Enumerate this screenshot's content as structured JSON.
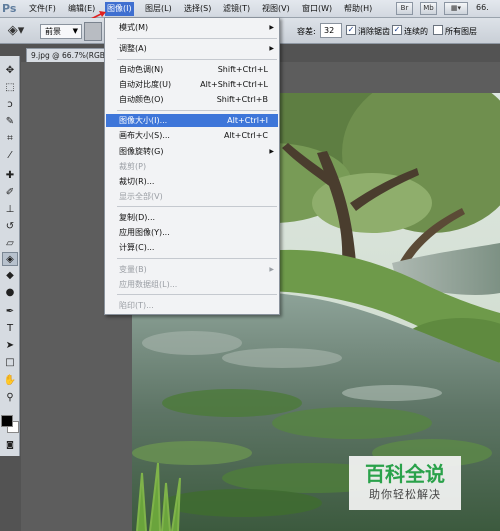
{
  "app": {
    "logo": "Ps"
  },
  "menubar": {
    "items": [
      "文件(F)",
      "编辑(E)",
      "图像(I)",
      "图层(L)",
      "选择(S)",
      "滤镜(T)",
      "视图(V)",
      "窗口(W)",
      "帮助(H)"
    ],
    "active_index": 2,
    "buttons": [
      "Br",
      "Mb"
    ],
    "zoom": "66."
  },
  "options": {
    "mode_value": "前景",
    "tolerance_label": "容差:",
    "tolerance_value": "32",
    "checkboxes": [
      {
        "label": "消除锯齿",
        "checked": true
      },
      {
        "label": "连续的",
        "checked": true
      },
      {
        "label": "所有图层",
        "checked": false
      }
    ]
  },
  "document": {
    "tab_title": "9.jpg @ 66.7%(RGB"
  },
  "image_menu": {
    "items": [
      {
        "label": "模式(M)",
        "shortcut": "",
        "submenu": true,
        "disabled": false
      },
      {
        "separator": true
      },
      {
        "label": "调整(A)",
        "shortcut": "",
        "submenu": true,
        "disabled": false
      },
      {
        "separator": true
      },
      {
        "label": "自动色调(N)",
        "shortcut": "Shift+Ctrl+L",
        "submenu": false,
        "disabled": false
      },
      {
        "label": "自动对比度(U)",
        "shortcut": "Alt+Shift+Ctrl+L",
        "submenu": false,
        "disabled": false
      },
      {
        "label": "自动颜色(O)",
        "shortcut": "Shift+Ctrl+B",
        "submenu": false,
        "disabled": false
      },
      {
        "separator": true
      },
      {
        "label": "图像大小(I)...",
        "shortcut": "Alt+Ctrl+I",
        "submenu": false,
        "disabled": false,
        "highlight": true
      },
      {
        "label": "画布大小(S)...",
        "shortcut": "Alt+Ctrl+C",
        "submenu": false,
        "disabled": false
      },
      {
        "label": "图像旋转(G)",
        "shortcut": "",
        "submenu": true,
        "disabled": false
      },
      {
        "label": "裁剪(P)",
        "shortcut": "",
        "submenu": false,
        "disabled": true
      },
      {
        "label": "裁切(R)...",
        "shortcut": "",
        "submenu": false,
        "disabled": false
      },
      {
        "label": "显示全部(V)",
        "shortcut": "",
        "submenu": false,
        "disabled": true
      },
      {
        "separator": true
      },
      {
        "label": "复制(D)...",
        "shortcut": "",
        "submenu": false,
        "disabled": false
      },
      {
        "label": "应用图像(Y)...",
        "shortcut": "",
        "submenu": false,
        "disabled": false
      },
      {
        "label": "计算(C)...",
        "shortcut": "",
        "submenu": false,
        "disabled": false
      },
      {
        "separator": true
      },
      {
        "label": "变量(B)",
        "shortcut": "",
        "submenu": true,
        "disabled": true
      },
      {
        "label": "应用数据组(L)...",
        "shortcut": "",
        "submenu": false,
        "disabled": true
      },
      {
        "separator": true
      },
      {
        "label": "陷印(T)...",
        "shortcut": "",
        "submenu": false,
        "disabled": true
      }
    ]
  },
  "tools": [
    {
      "name": "move-tool-icon",
      "glyph": "✥"
    },
    {
      "name": "marquee-tool-icon",
      "glyph": "⬚"
    },
    {
      "name": "lasso-tool-icon",
      "glyph": "ↄ"
    },
    {
      "name": "quick-select-tool-icon",
      "glyph": "✎"
    },
    {
      "name": "crop-tool-icon",
      "glyph": "⌗"
    },
    {
      "name": "eyedropper-tool-icon",
      "glyph": "⁄"
    },
    {
      "name": "healing-brush-tool-icon",
      "glyph": "✚"
    },
    {
      "name": "brush-tool-icon",
      "glyph": "✐"
    },
    {
      "name": "stamp-tool-icon",
      "glyph": "⊥"
    },
    {
      "name": "history-brush-tool-icon",
      "glyph": "↺"
    },
    {
      "name": "eraser-tool-icon",
      "glyph": "▱"
    },
    {
      "name": "paint-bucket-tool-icon",
      "glyph": "◈",
      "selected": true
    },
    {
      "name": "blur-tool-icon",
      "glyph": "◆"
    },
    {
      "name": "dodge-tool-icon",
      "glyph": "●"
    },
    {
      "name": "pen-tool-icon",
      "glyph": "✒"
    },
    {
      "name": "type-tool-icon",
      "glyph": "T"
    },
    {
      "name": "path-select-tool-icon",
      "glyph": "➤"
    },
    {
      "name": "shape-tool-icon",
      "glyph": "□"
    },
    {
      "name": "hand-tool-icon",
      "glyph": "✋"
    },
    {
      "name": "zoom-tool-icon",
      "glyph": "⚲"
    }
  ],
  "watermark": {
    "title": "百科全说",
    "subtitle": "助你轻松解决"
  },
  "colors": {
    "menu_highlight": "#3e76d9",
    "watermark_green": "#2aa24a"
  }
}
